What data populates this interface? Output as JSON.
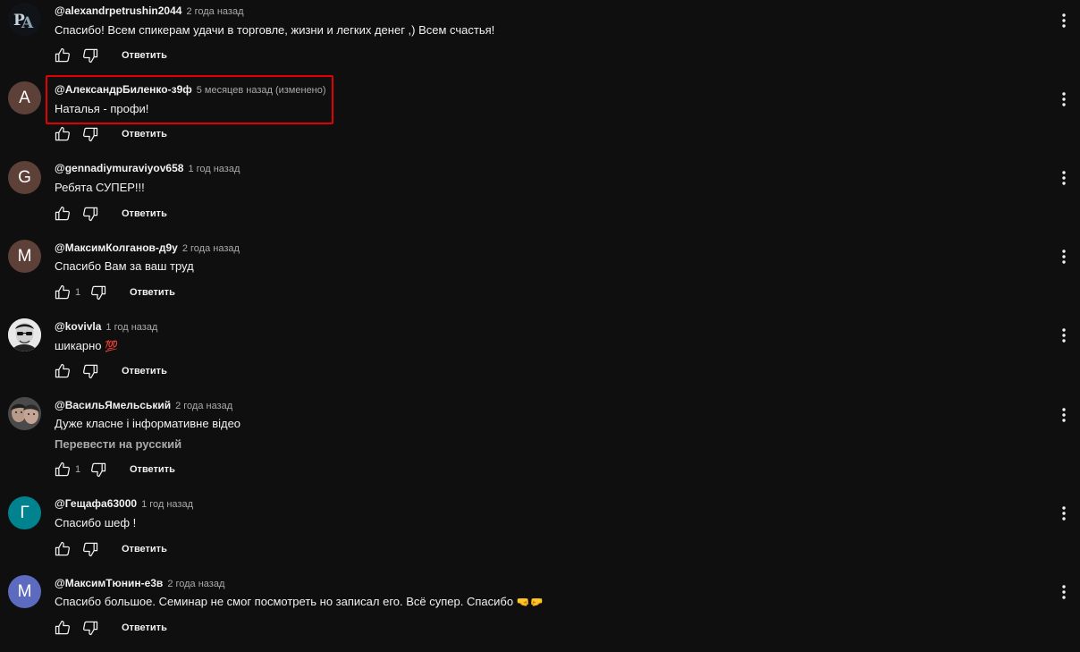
{
  "actions": {
    "reply_label": "Ответить"
  },
  "comments": [
    {
      "author": "@alexandrpetrushin2044",
      "time": "2 года назад",
      "text": "Спасибо! Всем спикерам удачи в торговле, жизни и легких денег ,) Всем счастья!",
      "avatar_kind": "logo",
      "avatar_logo_text": "PA",
      "avatar_color": "#101418"
    },
    {
      "author": "@АлександрБиленко-з9ф",
      "time": "5 месяцев назад (изменено)",
      "text": "Наталья - профи!",
      "avatar_letter": "A",
      "avatar_color": "#5d4037",
      "highlighted": true
    },
    {
      "author": "@gennadiymuraviyov658",
      "time": "1 год назад",
      "text": "Ребята СУПЕР!!!",
      "avatar_letter": "G",
      "avatar_color": "#5d4037"
    },
    {
      "author": "@МаксимКолганов-д9у",
      "time": "2 года назад",
      "text": "Спасибо Вам за ваш труд",
      "avatar_letter": "M",
      "avatar_color": "#5d4037",
      "likes": "1"
    },
    {
      "author": "@kovivla",
      "time": "1 год назад",
      "text": "шикарно",
      "emoji": "💯",
      "avatar_kind": "photo-face",
      "avatar_color": "#d8d8d8"
    },
    {
      "author": "@ВасильЯмельський",
      "time": "2 года назад",
      "text": "Дуже класне і інформативне відео",
      "translate": "Перевести на русский",
      "avatar_kind": "photo-couple",
      "avatar_color": "#3a3a3a",
      "likes": "1"
    },
    {
      "author": "@Гещафа63000",
      "time": "1 год назад",
      "text": "Спасибо шеф !",
      "avatar_letter": "Г",
      "avatar_color": "#00838f"
    },
    {
      "author": "@МаксимТюнин-е3в",
      "time": "2 года назад",
      "text": "Спасибо большое. Семинар не смог посмотреть но записал его. Всё супер. Спасибо",
      "emoji": "🤜🤛",
      "avatar_letter": "M",
      "avatar_color": "#5c6bc0"
    }
  ]
}
